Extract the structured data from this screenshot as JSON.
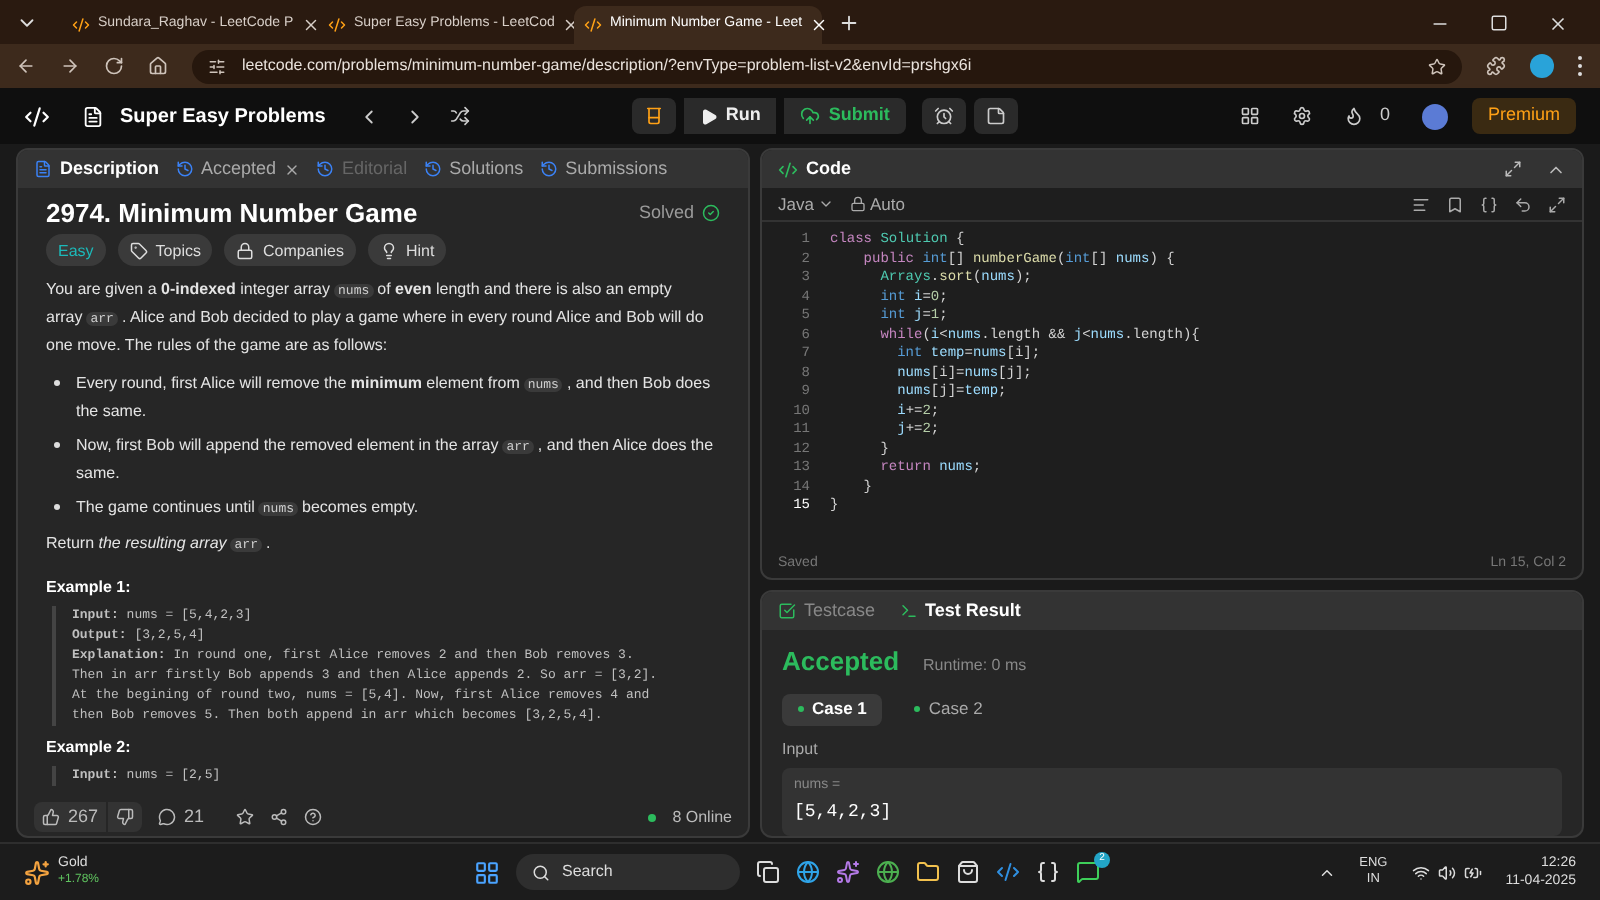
{
  "browser": {
    "tabs": [
      {
        "title": "Sundara_Raghav - LeetCode P",
        "selected": false
      },
      {
        "title": "Super Easy Problems - LeetCod",
        "selected": false
      },
      {
        "title": "Minimum Number Game - Leet",
        "selected": true
      }
    ],
    "url": "leetcode.com/problems/minimum-number-game/description/?envType=problem-list-v2&envId=prshgx6i"
  },
  "nav": {
    "list_title": "Super Easy Problems",
    "run": "Run",
    "submit": "Submit",
    "streak": "0",
    "premium": "Premium"
  },
  "left_tabs": [
    {
      "label": "Description",
      "selected": true,
      "disabled": false,
      "closable": false
    },
    {
      "label": "Accepted",
      "selected": false,
      "disabled": false,
      "closable": true
    },
    {
      "label": "Editorial",
      "selected": false,
      "disabled": true,
      "closable": false
    },
    {
      "label": "Solutions",
      "selected": false,
      "disabled": false,
      "closable": false
    },
    {
      "label": "Submissions",
      "selected": false,
      "disabled": false,
      "closable": false
    }
  ],
  "problem": {
    "title": "2974. Minimum Number Game",
    "status": "Solved",
    "tags": [
      {
        "label": "Easy",
        "kind": "difficulty"
      },
      {
        "label": "Topics",
        "kind": "topics"
      },
      {
        "label": "Companies",
        "kind": "companies"
      },
      {
        "label": "Hint",
        "kind": "hint"
      }
    ],
    "paragraphs": [
      {
        "kind": "para",
        "parts": [
          {
            "kind": "text",
            "text": "You are given a **0-indexed** integer array"
          },
          {
            "kind": "code",
            "text": "nums"
          },
          {
            "kind": "text",
            "text": "of **even** length and there is also an empty array"
          },
          {
            "kind": "code",
            "text": "arr"
          },
          {
            "kind": "text",
            "text": ". Alice and Bob decided to play a game where in every round Alice and Bob will do one move. The rules of the game are as follows:"
          }
        ]
      },
      {
        "kind": "bullet",
        "parts": [
          {
            "kind": "text",
            "text": "Every round, first Alice will remove the **minimum** element from"
          },
          {
            "kind": "code",
            "text": "nums"
          },
          {
            "kind": "text",
            "text": ", and then Bob does the same."
          }
        ]
      },
      {
        "kind": "bullet",
        "parts": [
          {
            "kind": "text",
            "text": "Now, first Bob will append the removed element in the array"
          },
          {
            "kind": "code",
            "text": "arr"
          },
          {
            "kind": "text",
            "text": ", and then Alice does the same."
          }
        ]
      },
      {
        "kind": "bullet",
        "parts": [
          {
            "kind": "text",
            "text": "The game continues until"
          },
          {
            "kind": "code",
            "text": "nums"
          },
          {
            "kind": "text",
            "text": "becomes empty."
          }
        ]
      },
      {
        "kind": "para",
        "parts": [
          {
            "kind": "text",
            "text": "Return *the resulting array*"
          },
          {
            "kind": "code",
            "text": "arr"
          },
          {
            "kind": "text",
            "text": "."
          }
        ]
      }
    ],
    "examples": [
      {
        "title": "Example 1:",
        "lines": [
          "**Input:** nums = [5,4,2,3]",
          "**Output:** [3,2,5,4]",
          "**Explanation:** In round one, first Alice removes 2 and then Bob removes 3.",
          "Then in arr firstly Bob appends 3 and then Alice appends 2. So arr = [3,2].",
          "At the begining of round two, nums = [5,4]. Now, first Alice removes 4 and",
          "then Bob removes 5. Then both append in arr which becomes [3,2,5,4]."
        ]
      },
      {
        "title": "Example 2:",
        "lines": [
          "**Input:** nums = [2,5]"
        ]
      }
    ],
    "likes": "267",
    "comments": "21",
    "online": "8 Online"
  },
  "code": {
    "title": "Code",
    "language": "Java",
    "mode": "Auto",
    "lines": [
      {
        "number": "1",
        "tokens": [
          {
            "text": "class ",
            "kind": "kw"
          },
          {
            "text": "Solution",
            "kind": "cls"
          },
          {
            "text": " {",
            "kind": "plain"
          }
        ]
      },
      {
        "number": "2",
        "tokens": [
          {
            "text": "    public ",
            "kind": "kw"
          },
          {
            "text": "int",
            "kind": "type"
          },
          {
            "text": "[] ",
            "kind": "plain"
          },
          {
            "text": "numberGame",
            "kind": "fn"
          },
          {
            "text": "(",
            "kind": "plain"
          },
          {
            "text": "int",
            "kind": "type"
          },
          {
            "text": "[] ",
            "kind": "plain"
          },
          {
            "text": "nums",
            "kind": "var"
          },
          {
            "text": ") {",
            "kind": "plain"
          }
        ]
      },
      {
        "number": "3",
        "tokens": [
          {
            "text": "      Arrays",
            "kind": "cls"
          },
          {
            "text": ".",
            "kind": "plain"
          },
          {
            "text": "sort",
            "kind": "fn"
          },
          {
            "text": "(",
            "kind": "plain"
          },
          {
            "text": "nums",
            "kind": "var"
          },
          {
            "text": ");",
            "kind": "plain"
          }
        ]
      },
      {
        "number": "4",
        "tokens": [
          {
            "text": "      int ",
            "kind": "type"
          },
          {
            "text": "i",
            "kind": "var"
          },
          {
            "text": "=",
            "kind": "plain"
          },
          {
            "text": "0",
            "kind": "num"
          },
          {
            "text": ";",
            "kind": "plain"
          }
        ]
      },
      {
        "number": "5",
        "tokens": [
          {
            "text": "      int ",
            "kind": "type"
          },
          {
            "text": "j",
            "kind": "var"
          },
          {
            "text": "=",
            "kind": "plain"
          },
          {
            "text": "1",
            "kind": "num"
          },
          {
            "text": ";",
            "kind": "plain"
          }
        ]
      },
      {
        "number": "6",
        "tokens": [
          {
            "text": "      while",
            "kind": "kw"
          },
          {
            "text": "(",
            "kind": "plain"
          },
          {
            "text": "i",
            "kind": "var"
          },
          {
            "text": "<",
            "kind": "plain"
          },
          {
            "text": "nums",
            "kind": "var"
          },
          {
            "text": ".length && ",
            "kind": "plain"
          },
          {
            "text": "j",
            "kind": "var"
          },
          {
            "text": "<",
            "kind": "plain"
          },
          {
            "text": "nums",
            "kind": "var"
          },
          {
            "text": ".length){",
            "kind": "plain"
          }
        ]
      },
      {
        "number": "7",
        "tokens": [
          {
            "text": "        int ",
            "kind": "type"
          },
          {
            "text": "temp",
            "kind": "var"
          },
          {
            "text": "=",
            "kind": "plain"
          },
          {
            "text": "nums",
            "kind": "var"
          },
          {
            "text": "[i];",
            "kind": "plain"
          }
        ]
      },
      {
        "number": "8",
        "tokens": [
          {
            "text": "        nums",
            "kind": "var"
          },
          {
            "text": "[i]=",
            "kind": "plain"
          },
          {
            "text": "nums",
            "kind": "var"
          },
          {
            "text": "[j];",
            "kind": "plain"
          }
        ]
      },
      {
        "number": "9",
        "tokens": [
          {
            "text": "        nums",
            "kind": "var"
          },
          {
            "text": "[j]=",
            "kind": "plain"
          },
          {
            "text": "temp",
            "kind": "var"
          },
          {
            "text": ";",
            "kind": "plain"
          }
        ]
      },
      {
        "number": "10",
        "tokens": [
          {
            "text": "        i",
            "kind": "var"
          },
          {
            "text": "+=",
            "kind": "plain"
          },
          {
            "text": "2",
            "kind": "num"
          },
          {
            "text": ";",
            "kind": "plain"
          }
        ]
      },
      {
        "number": "11",
        "tokens": [
          {
            "text": "        j",
            "kind": "var"
          },
          {
            "text": "+=",
            "kind": "plain"
          },
          {
            "text": "2",
            "kind": "num"
          },
          {
            "text": ";",
            "kind": "plain"
          }
        ]
      },
      {
        "number": "12",
        "tokens": [
          {
            "text": "      }",
            "kind": "plain"
          }
        ]
      },
      {
        "number": "13",
        "tokens": [
          {
            "text": "      return ",
            "kind": "kw"
          },
          {
            "text": "nums",
            "kind": "var"
          },
          {
            "text": ";",
            "kind": "plain"
          }
        ]
      },
      {
        "number": "14",
        "tokens": [
          {
            "text": "    }",
            "kind": "plain"
          }
        ]
      },
      {
        "number": "15",
        "tokens": [
          {
            "text": "}",
            "kind": "plain"
          }
        ]
      }
    ],
    "status": "Saved",
    "cursor": "Ln 15, Col 2"
  },
  "tests": {
    "tabs": [
      {
        "label": "Testcase",
        "selected": false
      },
      {
        "label": "Test Result",
        "selected": true
      }
    ],
    "result": "Accepted",
    "runtime": "Runtime: 0 ms",
    "cases": [
      {
        "label": "Case 1",
        "selected": true
      },
      {
        "label": "Case 2",
        "selected": false
      }
    ],
    "input_label": "Input",
    "variable": "nums =",
    "value": "[5,4,2,3]"
  },
  "taskbar": {
    "widget_title": "Gold",
    "widget_change": "+1.78%",
    "search": "Search",
    "whatsapp_badge": "2",
    "language": "ENG",
    "region": "IN",
    "time": "12:26",
    "date": "11-04-2025"
  }
}
